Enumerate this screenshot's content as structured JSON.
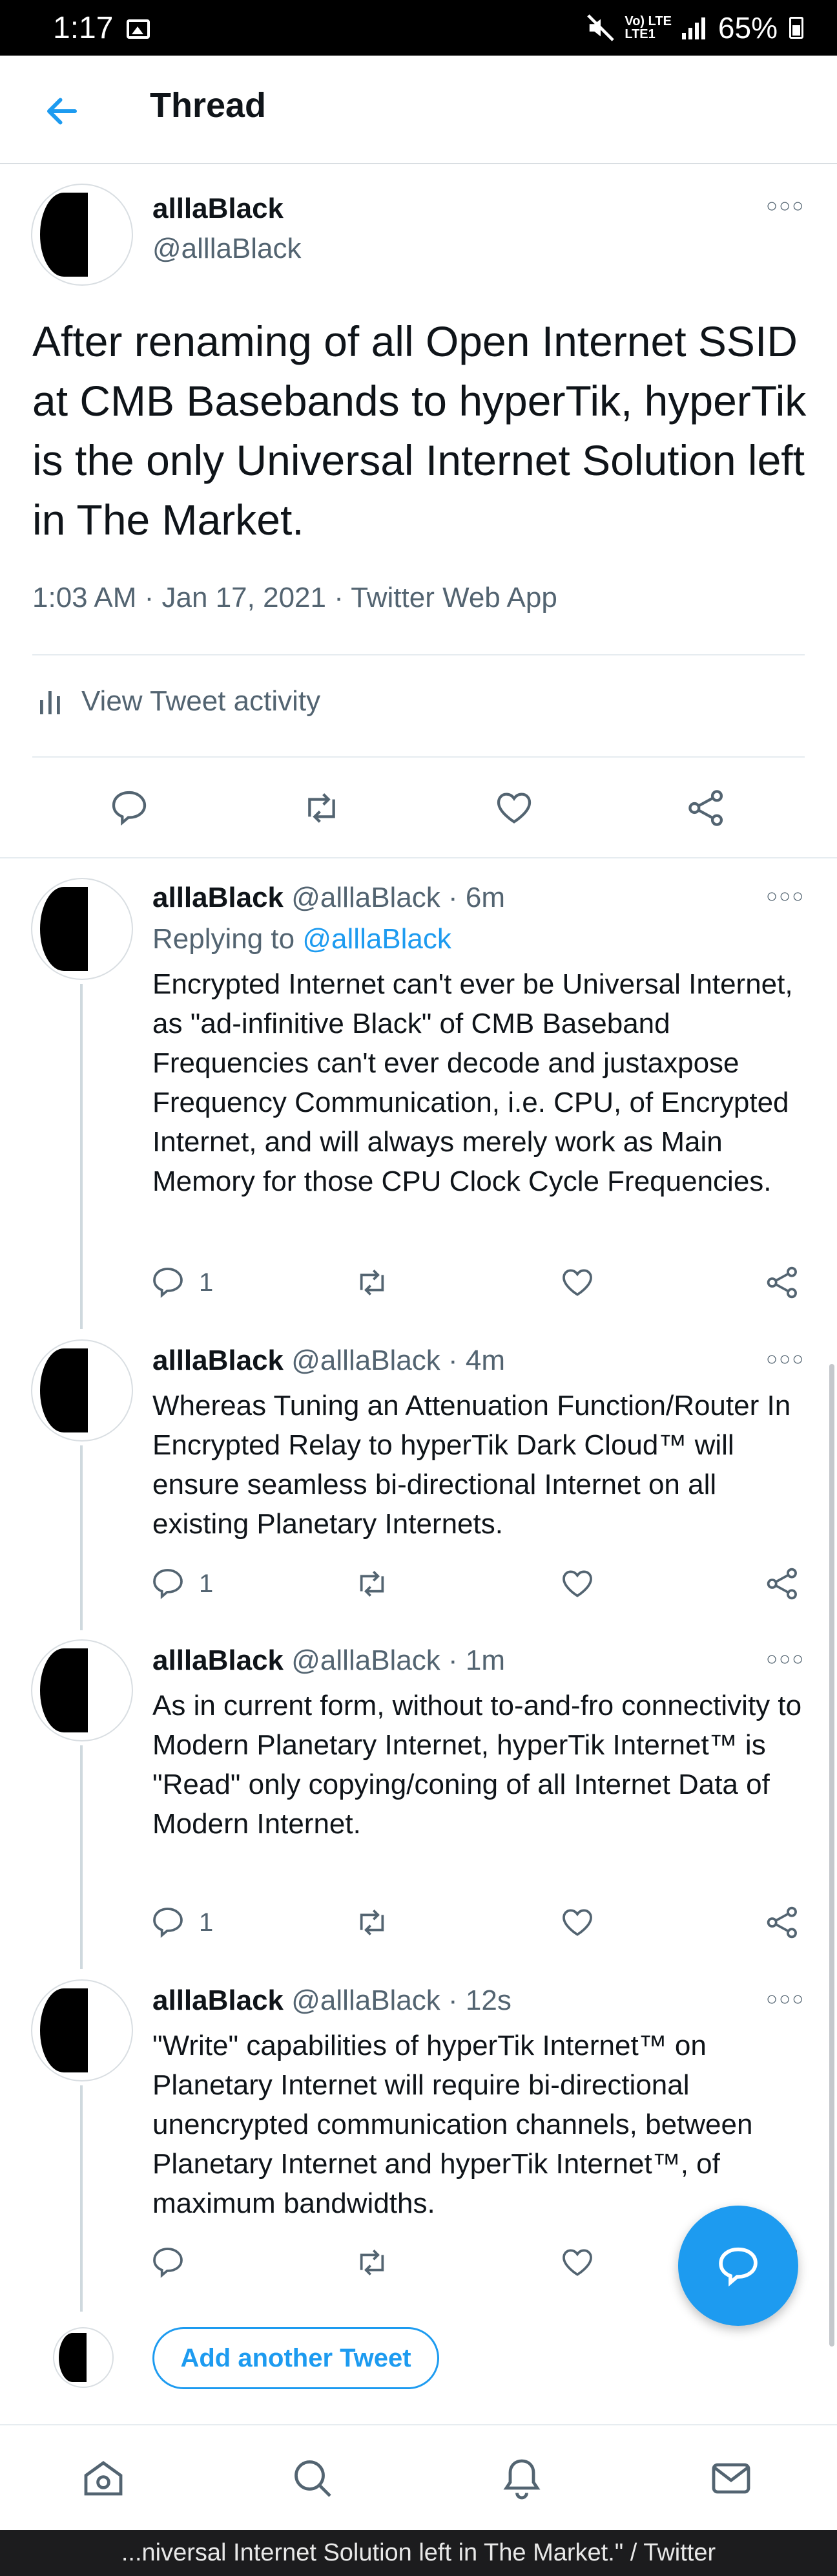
{
  "status_bar": {
    "time": "1:17",
    "signal_text": "Vo) LTE",
    "signal_sub": "LTE1",
    "battery": "65%"
  },
  "header": {
    "title": "Thread",
    "back_icon": "arrow-left-icon"
  },
  "main_tweet": {
    "name": "alllaBlack",
    "handle": "@alllaBlack",
    "text": "After renaming of all Open Internet SSID at CMB Basebands to hyperTik, hyperTik is the only Universal Internet Solution left in The Market.",
    "meta": "1:03 AM · Jan 17, 2021 · Twitter Web App",
    "activity_label": "View Tweet activity"
  },
  "replies": [
    {
      "name": "alllaBlack",
      "meta": "@alllaBlack · 6m",
      "replying_prefix": "Replying to",
      "replying_handle": "@alllaBlack",
      "text": "Encrypted Internet can't ever be Universal Internet, as \"ad-infinitive Black\" of CMB Baseband Frequencies can't ever decode and justaxpose Frequency Communication, i.e. CPU, of Encrypted Internet, and will always merely work as Main Memory for those CPU Clock Cycle Frequencies.",
      "reply_count": "1"
    },
    {
      "name": "alllaBlack",
      "meta": "@alllaBlack · 4m",
      "text": "Whereas Tuning an Attenuation Function/Router In Encrypted Relay to hyperTik Dark Cloud™ will ensure seamless bi-directional Internet on all existing Planetary Internets.",
      "reply_count": "1"
    },
    {
      "name": "alllaBlack",
      "meta": "@alllaBlack · 1m",
      "text": "As in current form, without to-and-fro connectivity to Modern Planetary Internet, hyperTik Internet™ is \"Read\" only copying/coning of all Internet Data of Modern Internet.",
      "reply_count": "1"
    },
    {
      "name": "alllaBlack",
      "meta": "@alllaBlack · 12s",
      "text": "\"Write\" capabilities of hyperTik Internet™ on Planetary Internet will require bi-directional unencrypted communication channels, between Planetary Internet and hyperTik Internet™, of maximum bandwidths.",
      "reply_count": ""
    }
  ],
  "add_tweet_label": "Add another Tweet",
  "footer_text": "...niversal Internet Solution left in The Market.\" / Twitter",
  "colors": {
    "accent": "#1d9bf0",
    "secondary_text": "#536471",
    "divider": "#e6ecf0"
  },
  "icons": [
    "reply-icon",
    "retweet-icon",
    "like-icon",
    "share-icon",
    "home-icon",
    "search-icon",
    "notifications-icon",
    "messages-icon",
    "compose-icon"
  ]
}
